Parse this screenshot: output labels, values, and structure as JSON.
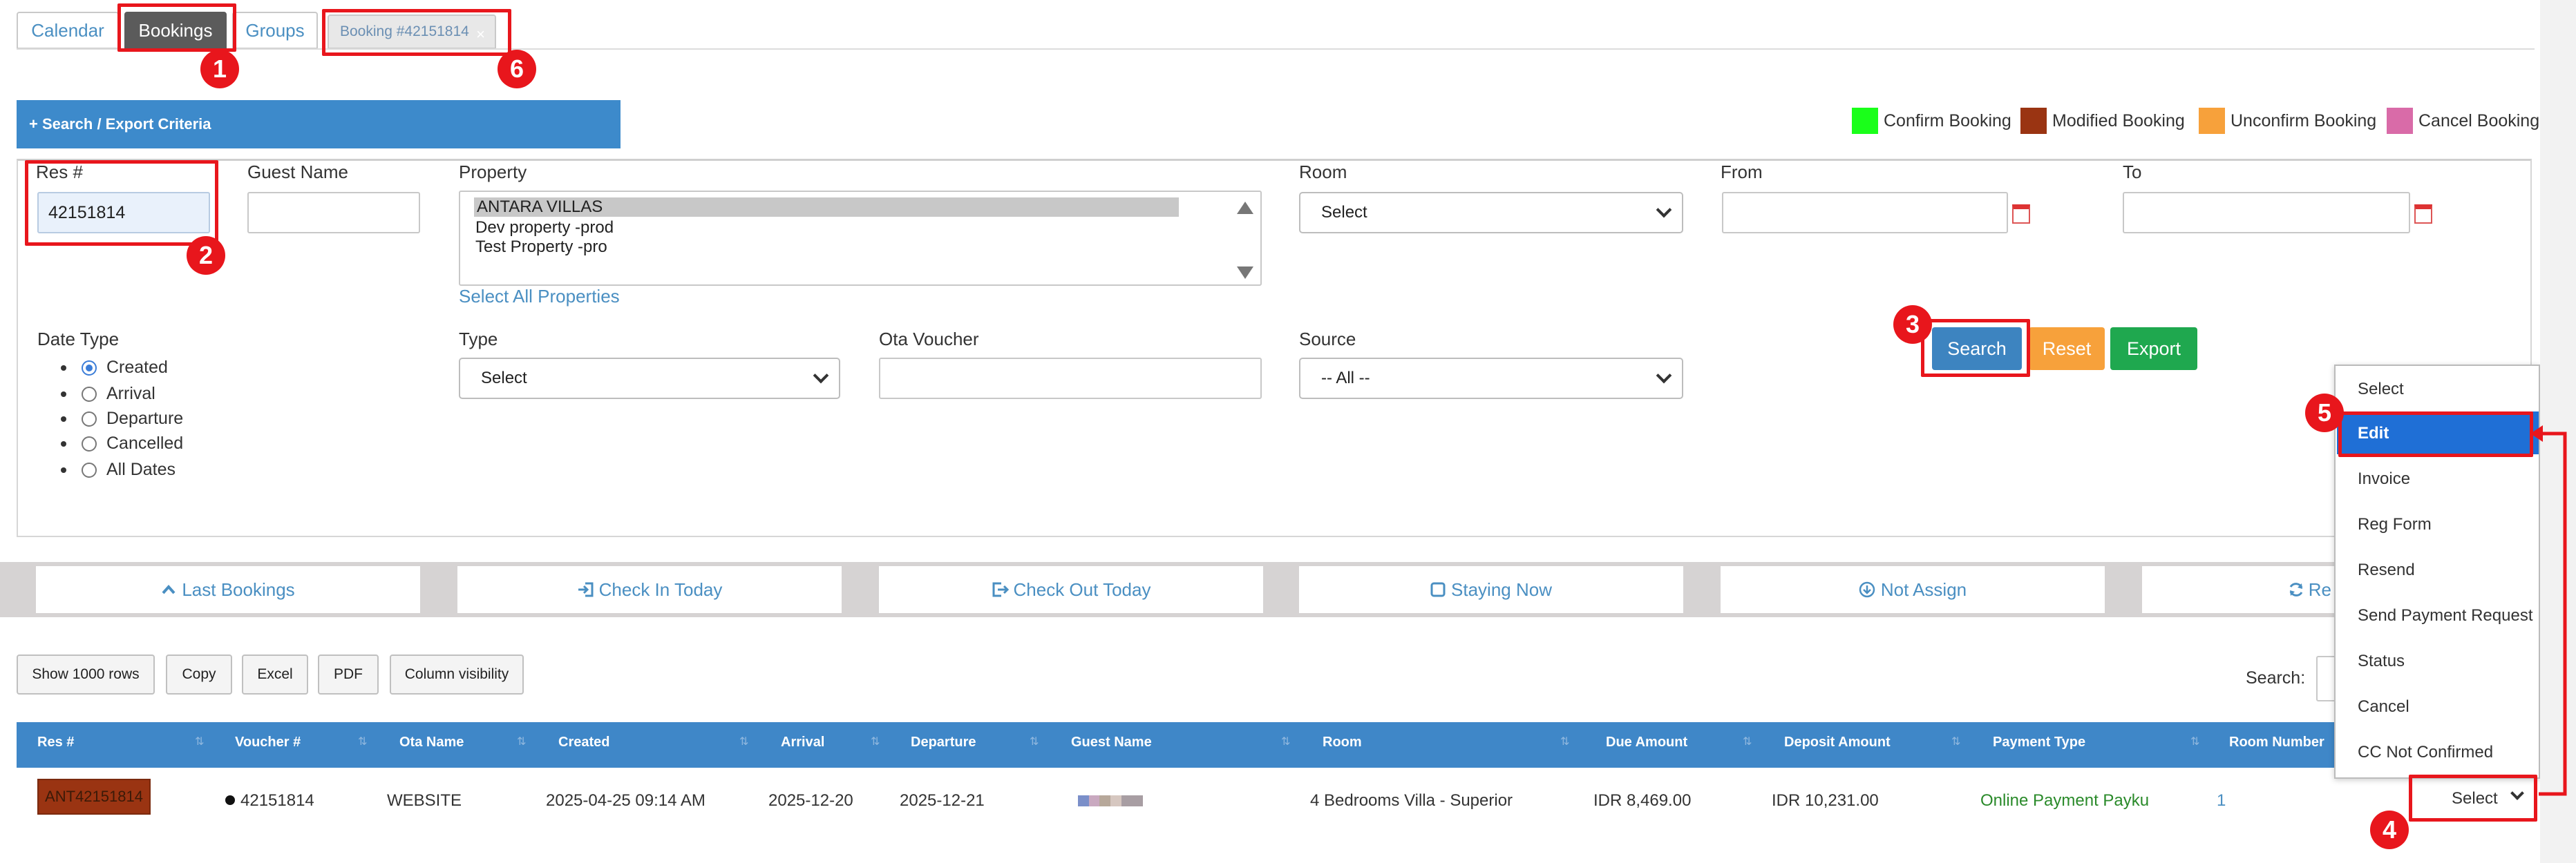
{
  "tabs": {
    "calendar": "Calendar",
    "bookings": "Bookings",
    "groups": "Groups",
    "booking": "Booking #42151814",
    "close": "×"
  },
  "criteria": {
    "toggle_label": "+ Search / Export Criteria"
  },
  "legend": [
    {
      "label": "Confirm Booking",
      "color": "#1aff1a"
    },
    {
      "label": "Modified Booking",
      "color": "#9a3412"
    },
    {
      "label": "Unconfirm Booking",
      "color": "#f7a13b"
    },
    {
      "label": "Cancel Booking",
      "color": "#d96ba8"
    }
  ],
  "filters": {
    "res_label": "Res #",
    "res_value": "42151814",
    "guest_label": "Guest Name",
    "guest_value": "",
    "property_label": "Property",
    "property_options": [
      "ANTARA VILLAS",
      "Dev property -prod",
      "Test Property -pro"
    ],
    "select_all": "Select All Properties",
    "room_label": "Room",
    "room_value": "Select",
    "from_label": "From",
    "to_label": "To",
    "date_type_label": "Date Type",
    "date_types": [
      "Created",
      "Arrival",
      "Departure",
      "Cancelled",
      "All Dates"
    ],
    "type_label": "Type",
    "type_value": "Select",
    "ota_label": "Ota Voucher",
    "source_label": "Source",
    "source_value": "-- All --"
  },
  "buttons": {
    "search": "Search",
    "reset": "Reset",
    "export": "Export"
  },
  "quick": {
    "last": "Last Bookings",
    "checkin": "Check In Today",
    "checkout": "Check Out Today",
    "staying": "Staying Now",
    "notassign": "Not Assign",
    "refresh": "Re"
  },
  "table_tools": {
    "show_rows": "Show 1000 rows",
    "copy": "Copy",
    "excel": "Excel",
    "pdf": "PDF",
    "column_visibility": "Column visibility",
    "search_label": "Search:"
  },
  "table": {
    "headers": [
      "Res #",
      "Voucher #",
      "Ota Name",
      "Created",
      "Arrival",
      "Departure",
      "Guest Name",
      "Room",
      "Due Amount",
      "Deposit Amount",
      "Payment Type",
      "Room Number"
    ],
    "row": {
      "res": "ANT42151814",
      "voucher": "42151814",
      "ota": "WEBSITE",
      "created": "2025-04-25 09:14 AM",
      "arrival": "2025-12-20",
      "departure": "2025-12-21",
      "room": "4 Bedrooms Villa - Superior",
      "due": "IDR 8,469.00",
      "deposit": "IDR 10,231.00",
      "payment": "Online Payment Payku",
      "room_number": "1",
      "action": "Select"
    }
  },
  "menu": [
    "Select",
    "Edit",
    "Invoice",
    "Reg Form",
    "Resend",
    "Send Payment Request",
    "Status",
    "Cancel",
    "CC Not Confirmed"
  ],
  "steps": [
    "1",
    "2",
    "3",
    "4",
    "5",
    "6"
  ]
}
